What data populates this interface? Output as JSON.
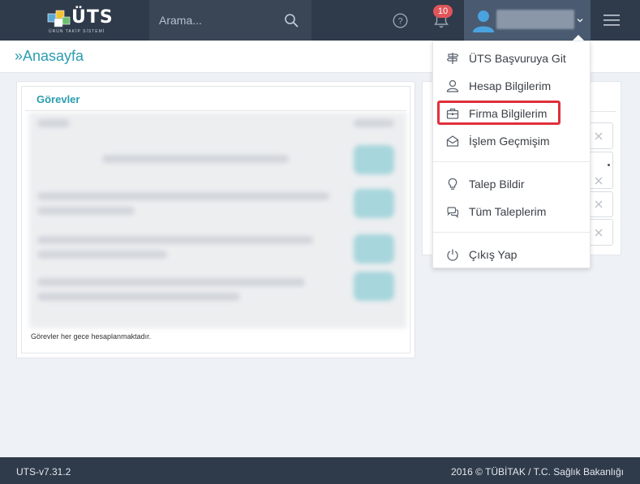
{
  "header": {
    "logo_text": "ÜTS",
    "logo_subtitle": "ÜRÜN TAKİP SİSTEMİ",
    "search_placeholder": "Arama...",
    "notification_count": "10"
  },
  "breadcrumb": "»Anasayfa",
  "tasks_card": {
    "title": "Görevler",
    "note": "Görevler her gece hesaplanmaktadır."
  },
  "dropdown": {
    "items": [
      {
        "label": "ÜTS Başvuruya Git",
        "icon": "signpost-icon"
      },
      {
        "label": "Hesap Bilgilerim",
        "icon": "user-icon"
      },
      {
        "label": "Firma Bilgilerim",
        "icon": "briefcase-icon"
      },
      {
        "label": "İşlem Geçmişim",
        "icon": "envelope-open-icon"
      },
      {
        "label": "Talep Bildir",
        "icon": "lightbulb-icon"
      },
      {
        "label": "Tüm Taleplerim",
        "icon": "chat-bubbles-icon"
      },
      {
        "label": "Çıkış Yap",
        "icon": "power-icon"
      }
    ],
    "highlighted": "Firma Bilgilerim"
  },
  "footer": {
    "version": "UTS-v7.31.2",
    "copyright": "2016 © TÜBİTAK / T.C. Sağlık Bakanlığı"
  },
  "colors": {
    "topbar": "#2f3a4a",
    "accent": "#2a9db0",
    "badge": "#e0555a",
    "highlight": "#e0303a"
  }
}
